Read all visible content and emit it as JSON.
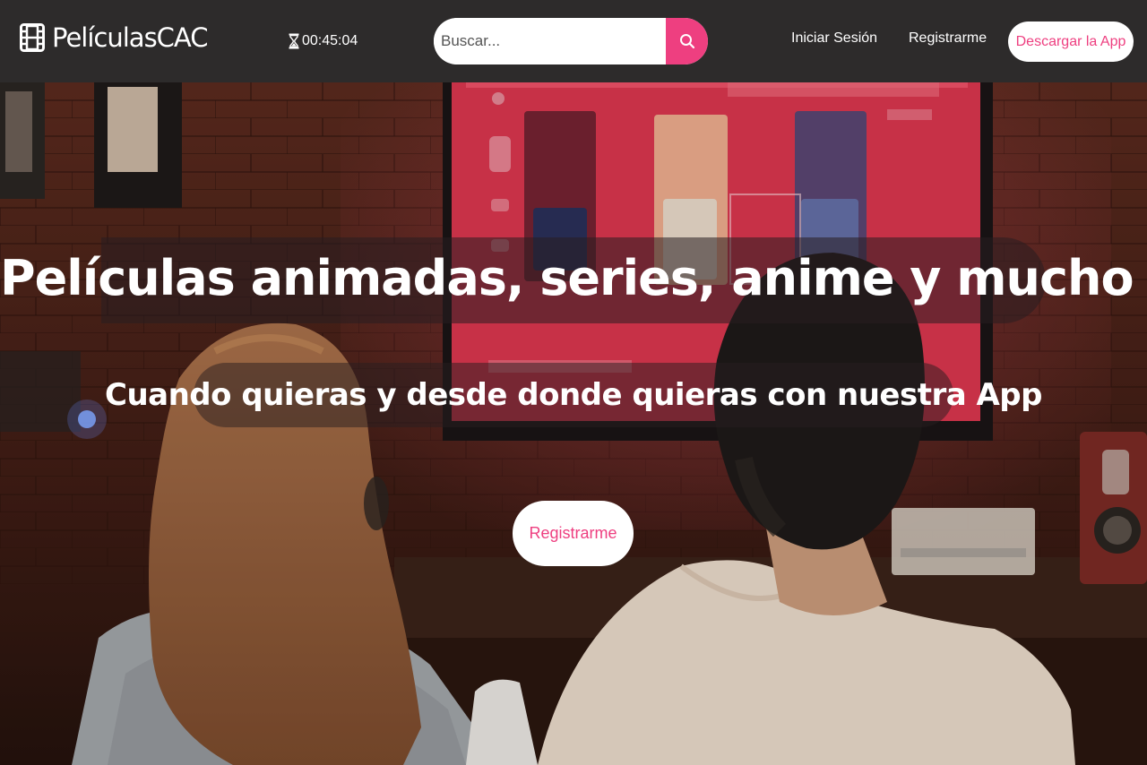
{
  "navbar": {
    "brand": {
      "name": "PelículasCAC",
      "icon": "film-icon"
    },
    "timer": {
      "value": "00:45:04",
      "icon": "hourglass-icon"
    },
    "search": {
      "placeholder": "Buscar...",
      "value": "",
      "button_icon": "search-icon"
    },
    "links": {
      "login": "Iniciar Sesión",
      "register": "Registrarme"
    },
    "download_button": "Descargar la App"
  },
  "hero": {
    "title": "Películas animadas, series, anime y mucho más",
    "subtitle": "Cuando quieras y desde donde quieras con nuestra App",
    "cta_button": "Registrarme",
    "background": "photo of two people watching a TV with a streaming app"
  },
  "colors": {
    "navbar_bg": "#2d2b2b",
    "accent": "#ee3f80",
    "text": "#ffffff",
    "button_bg": "#ffffff"
  }
}
